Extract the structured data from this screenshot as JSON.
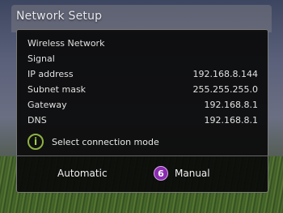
{
  "window": {
    "title": "Network Setup"
  },
  "settings": [
    {
      "label": "Wireless Network",
      "value": ""
    },
    {
      "label": "Signal",
      "value": ""
    },
    {
      "label": "IP address",
      "value": "192.168.8.144"
    },
    {
      "label": "Subnet mask",
      "value": "255.255.255.0"
    },
    {
      "label": "Gateway",
      "value": "192.168.8.1"
    },
    {
      "label": "DNS",
      "value": "192.168.8.1"
    }
  ],
  "info": {
    "icon": "info-icon",
    "glyph": "i",
    "text": "Select connection mode"
  },
  "buttons": {
    "automatic": "Automatic",
    "manual": "Manual",
    "manual_badge": "6"
  },
  "colors": {
    "info_green": "#8fb342",
    "badge_purple": "#8a2bb0"
  }
}
